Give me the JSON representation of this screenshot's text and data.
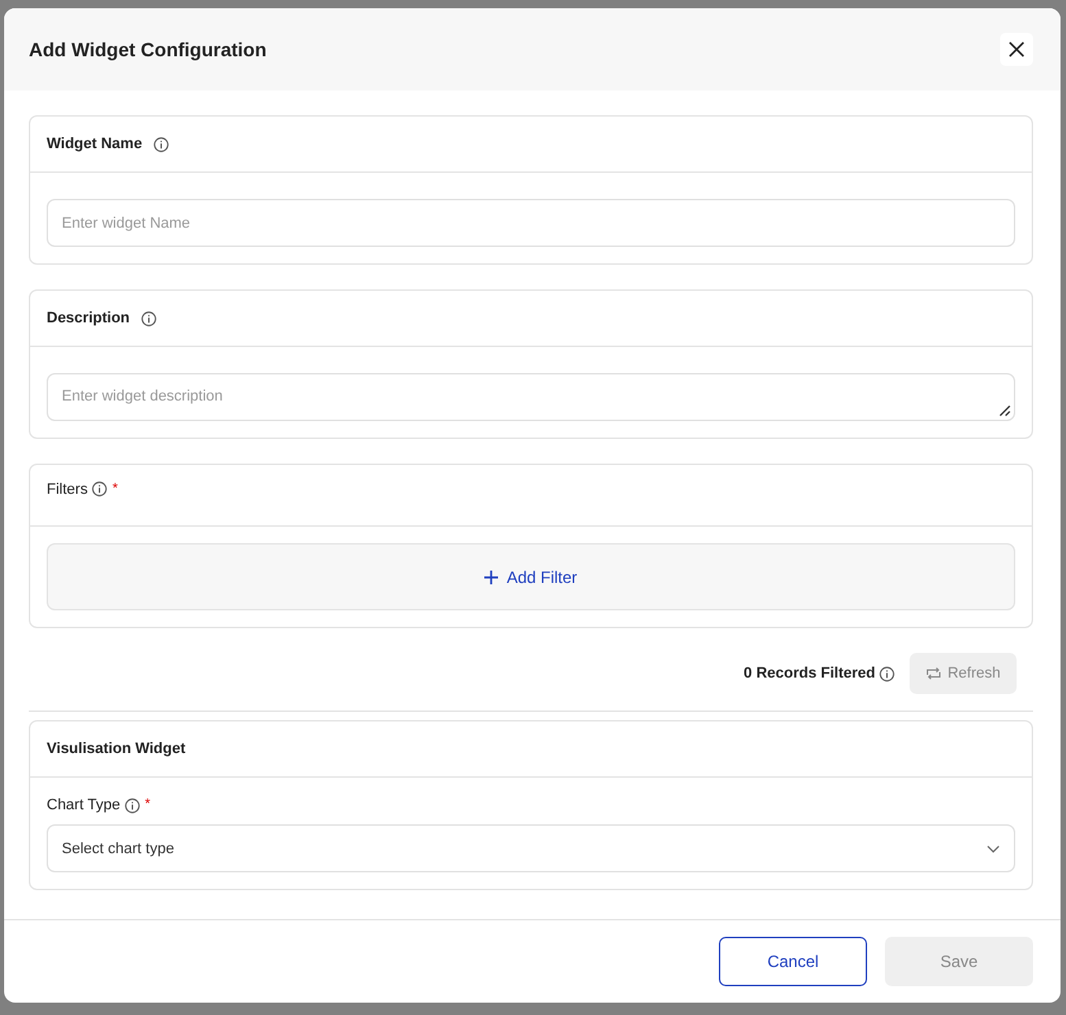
{
  "dialog": {
    "title": "Add Widget Configuration"
  },
  "sections": [
    {
      "kind": "text",
      "title": "Widget Name",
      "placeholder": "Enter widget Name"
    },
    {
      "kind": "textarea",
      "title": "Description",
      "placeholder": "Enter widget description"
    },
    {
      "kind": "filters",
      "title": "Filters",
      "required_mark": "*",
      "add_button": "Add Filter"
    }
  ],
  "records": {
    "text": "0 Records Filtered",
    "refresh": {
      "label": "Refresh",
      "disabled": true
    }
  },
  "visualisation": {
    "title": "Visulisation Widget",
    "field": {
      "label": "Chart Type",
      "required_mark": "*",
      "value": "Select chart type"
    }
  },
  "footer": {
    "cancel": {
      "label": "Cancel",
      "disabled": false
    },
    "save": {
      "label": "Save",
      "disabled": true
    }
  }
}
